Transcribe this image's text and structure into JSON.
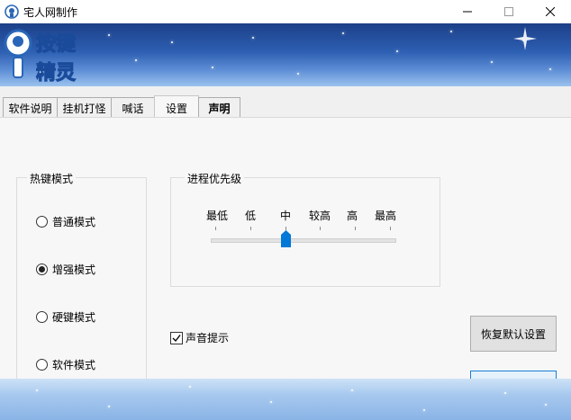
{
  "window": {
    "title": "宅人网制作",
    "controls": [
      "minimize",
      "maximize",
      "close"
    ]
  },
  "logo": {
    "line1": "按键",
    "line2": "精灵"
  },
  "tabs": [
    {
      "label": "软件说明",
      "active": false,
      "bold": false
    },
    {
      "label": "挂机打怪",
      "active": false,
      "bold": false
    },
    {
      "label": "喊话",
      "active": false,
      "bold": false
    },
    {
      "label": "设置",
      "active": true,
      "bold": false
    },
    {
      "label": "声明",
      "active": false,
      "bold": true
    }
  ],
  "hotkey_mode": {
    "title": "热键模式",
    "options": [
      {
        "label": "普通模式",
        "checked": false
      },
      {
        "label": "增强模式",
        "checked": true
      },
      {
        "label": "硬键模式",
        "checked": false
      },
      {
        "label": "软件模式",
        "checked": false
      }
    ]
  },
  "priority": {
    "title": "进程优先级",
    "levels": [
      "最低",
      "低",
      "中",
      "较高",
      "高",
      "最高"
    ],
    "selected": "中"
  },
  "sound": {
    "label": "声音提示",
    "checked": true
  },
  "restore_button": "恢复默认设置",
  "colors": {
    "accent": "#0078d7",
    "banner_dark": "#1c3f88",
    "banner_light": "#9cc3ee"
  }
}
